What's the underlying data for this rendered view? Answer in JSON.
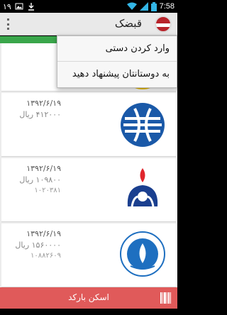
{
  "status_bar": {
    "left_number": "۱۹",
    "time": "7:58"
  },
  "app": {
    "title": "قبضک"
  },
  "menu": {
    "items": [
      {
        "label": "وارد کردن دستی"
      },
      {
        "label": "به دوستانتان پیشنهاد دهید"
      }
    ]
  },
  "bills": [
    {
      "date": "۱۳۹۲/۶/۱۹",
      "amount": "۴۱۲۰۰۰ ریال",
      "id": "",
      "company_icon": "telecom-logo-icon",
      "logo_color": "#1a59a8"
    },
    {
      "date": "۱۳۹۲/۶/۱۹",
      "amount": "۱۰۹۸۰۰ ریال",
      "id": "۱۰۲۰۳۸۱",
      "company_icon": "gas-company-logo-icon",
      "logo_color": "#1a3f8f"
    },
    {
      "date": "۱۳۹۲/۶/۱۹",
      "amount": "۱۵۶۰۰۰۰ ریال",
      "id": "۱۰۸۸۲۶۰۹",
      "company_icon": "water-company-logo-icon",
      "logo_color": "#1e6fc0"
    }
  ],
  "scan_button": {
    "label": "اسکن بارکد"
  },
  "colors": {
    "accent": "#e05a5a",
    "action_bar": "#e9e9e9",
    "green_strip": "#3aa64b"
  }
}
